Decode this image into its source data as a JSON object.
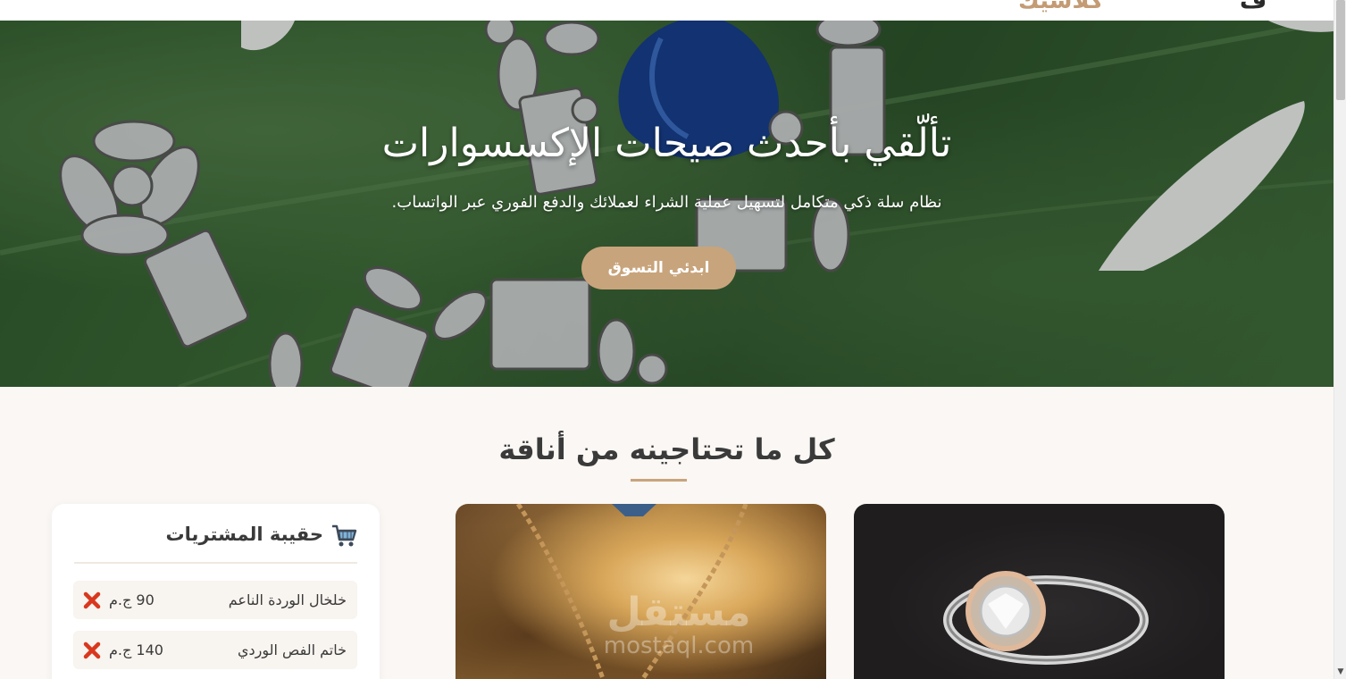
{
  "header": {
    "fragment_brand": "كلاسيك",
    "fragment_menu": "ف"
  },
  "hero": {
    "title": "تألّقي بأحدث صيحات الإكسسوارات",
    "subtitle": "نظام سلة ذكي متكامل لتسهيل عملية الشراء لعملائك والدفع الفوري عبر الواتساب.",
    "cta_label": "ابدئي التسوق"
  },
  "section": {
    "title": "كل ما تحتاجينه من أناقة"
  },
  "cart": {
    "title": "حقيبة المشتريات",
    "items": [
      {
        "name": "خلخال الوردة الناعم",
        "price": "90 ج.م"
      },
      {
        "name": "خاتم الفص الوردي",
        "price": "140 ج.م"
      }
    ]
  },
  "watermark": {
    "text": "مستقل",
    "domain": "mostaql.com"
  },
  "colors": {
    "accent": "#c8a47c",
    "background": "#faf7f4",
    "text": "#3a3a3a",
    "remove": "#d9381e"
  }
}
